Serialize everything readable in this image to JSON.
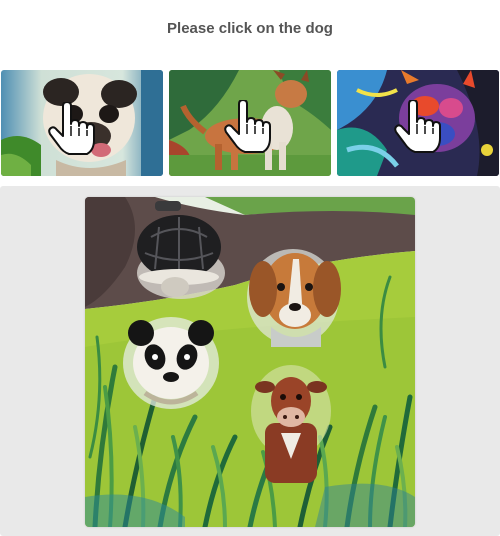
{
  "prompt": {
    "text": "Please click on the dog"
  },
  "examples": [
    {
      "subject": "pug-dog",
      "icon": "hand-pointer-icon"
    },
    {
      "subject": "hound-dog",
      "icon": "hand-pointer-icon"
    },
    {
      "subject": "colorful-dog",
      "icon": "hand-pointer-icon"
    }
  ],
  "challenge": {
    "animals": [
      "turtle",
      "dog",
      "panda",
      "cow"
    ]
  },
  "colors": {
    "panel_bg": "#e9e9e9",
    "prompt_text": "#555555",
    "grass": "#9bc43a",
    "earth": "#5a4a48"
  }
}
